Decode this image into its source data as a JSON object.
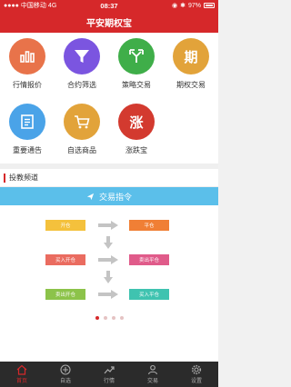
{
  "status": {
    "carrier": "中国移动",
    "network": "4G",
    "time": "08:37",
    "battery": "97%"
  },
  "header": {
    "title": "平安期权宝"
  },
  "grid": [
    {
      "label": "行情报价",
      "color": "#e8734a",
      "icon": "bar-chart-icon"
    },
    {
      "label": "合约筛选",
      "color": "#7b55e0",
      "icon": "funnel-icon"
    },
    {
      "label": "策略交易",
      "color": "#3fae49",
      "icon": "split-arrow-icon"
    },
    {
      "label": "期权交易",
      "color": "#e2a33a",
      "icon": "qi-character-icon",
      "glyph": "期"
    },
    {
      "label": "重要通告",
      "color": "#4aa3e8",
      "icon": "document-icon"
    },
    {
      "label": "自选商品",
      "color": "#e2a33a",
      "icon": "cart-icon"
    },
    {
      "label": "涨跌宝",
      "color": "#d33a2f",
      "icon": "zhang-character-icon",
      "glyph": "涨"
    }
  ],
  "section": {
    "title": "投教频道"
  },
  "banner": {
    "title": "交易指令"
  },
  "diagram": {
    "boxes": [
      {
        "text": "开仓",
        "color": "#f4c13c"
      },
      {
        "text": "平仓",
        "color": "#f07f35"
      },
      {
        "text": "买入开仓",
        "color": "#ea6c60"
      },
      {
        "text": "卖出平仓",
        "color": "#e05b8a"
      },
      {
        "text": "卖出开仓",
        "color": "#8cc34a"
      },
      {
        "text": "买入平仓",
        "color": "#3fc3b0"
      }
    ]
  },
  "carousel": {
    "pages": 4,
    "active": 0
  },
  "tabs": [
    {
      "label": "首页",
      "icon": "home-icon",
      "active": true
    },
    {
      "label": "自选",
      "icon": "plus-circle-icon",
      "active": false
    },
    {
      "label": "行情",
      "icon": "trend-icon",
      "active": false
    },
    {
      "label": "交易",
      "icon": "person-icon",
      "active": false
    },
    {
      "label": "设置",
      "icon": "gear-icon",
      "active": false
    }
  ]
}
